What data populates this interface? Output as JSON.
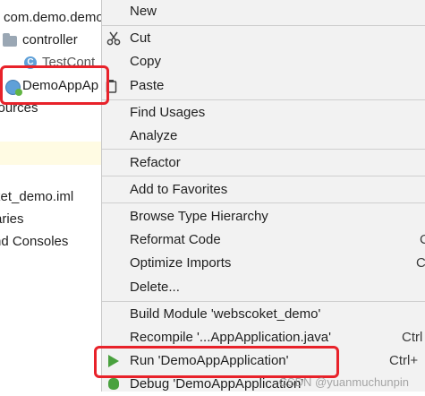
{
  "tree": {
    "rows": [
      {
        "label": "com.demo.demo"
      },
      {
        "label": "controller"
      },
      {
        "label": "TestCont"
      },
      {
        "label": "DemoAppAp"
      },
      {
        "label": "sources"
      },
      {
        "label": "ket_demo.iml"
      },
      {
        "label": "aries"
      },
      {
        "label": "nd Consoles"
      }
    ],
    "class_icon_letter": "C"
  },
  "menu": {
    "items": [
      {
        "label": "New",
        "shortcut": ""
      },
      {
        "label": "Cut",
        "shortcut": ""
      },
      {
        "label": "Copy",
        "shortcut": ""
      },
      {
        "label": "Paste",
        "shortcut": ""
      },
      {
        "label": "Find Usages",
        "shortcut": ""
      },
      {
        "label": "Analyze",
        "shortcut": ""
      },
      {
        "label": "Refactor",
        "shortcut": ""
      },
      {
        "label": "Add to Favorites",
        "shortcut": ""
      },
      {
        "label": "Browse Type Hierarchy",
        "shortcut": ""
      },
      {
        "label": "Reformat Code",
        "shortcut": "C"
      },
      {
        "label": "Optimize Imports",
        "shortcut": "C"
      },
      {
        "label": "Delete...",
        "shortcut": ""
      },
      {
        "label": "Build Module 'webscoket_demo'",
        "shortcut": ""
      },
      {
        "label": "Recompile '...AppApplication.java'",
        "shortcut": "Ctrl"
      },
      {
        "label": "Run 'DemoAppApplication'",
        "shortcut": "Ctrl+"
      },
      {
        "label": "Debug 'DemoAppApplication'",
        "shortcut": ""
      }
    ]
  },
  "watermark": "CSDN @yuanmuchunpin",
  "colors": {
    "annotation": "#e8222a",
    "run_green": "#49a13e",
    "menu_bg": "#f2f2f2"
  },
  "icons": {
    "cut": "scissors-icon",
    "paste": "clipboard-icon",
    "run": "run-triangle-icon",
    "debug": "bug-icon"
  }
}
